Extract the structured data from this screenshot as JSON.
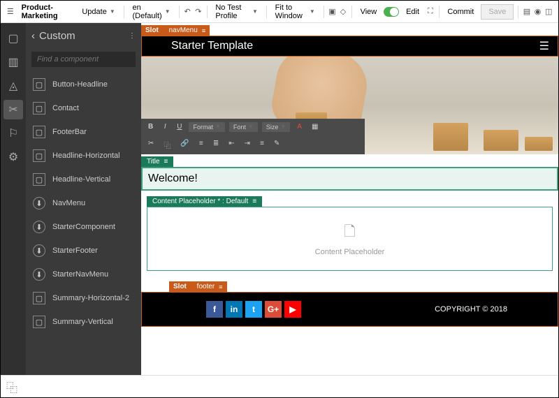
{
  "toolbar": {
    "product": "Product-Marketing",
    "update": "Update",
    "locale": "en (Default)",
    "testProfile": "No Test Profile",
    "fit": "Fit to Window",
    "view": "View",
    "edit": "Edit",
    "commit": "Commit",
    "save": "Save"
  },
  "sidebar": {
    "title": "Custom",
    "searchPlaceholder": "Find a component",
    "items": [
      {
        "label": "Button-Headline",
        "dl": false
      },
      {
        "label": "Contact",
        "dl": false
      },
      {
        "label": "FooterBar",
        "dl": false
      },
      {
        "label": "Headline-Horizontal",
        "dl": false
      },
      {
        "label": "Headline-Vertical",
        "dl": false
      },
      {
        "label": "NavMenu",
        "dl": true
      },
      {
        "label": "StarterComponent",
        "dl": true
      },
      {
        "label": "StarterFooter",
        "dl": true
      },
      {
        "label": "StarterNavMenu",
        "dl": true
      },
      {
        "label": "Summary-Horizontal-2",
        "dl": false
      },
      {
        "label": "Summary-Vertical",
        "dl": false
      }
    ]
  },
  "canvas": {
    "slotNav": {
      "slot": "Slot",
      "name": "navMenu"
    },
    "navTitle": "Starter Template",
    "rte": {
      "bold": "B",
      "italic": "I",
      "underline": "U",
      "format": "Format",
      "font": "Font",
      "size": "Size"
    },
    "titleTag": "Title",
    "titleText": "Welcome!",
    "cpTag": "Content Placeholder  * : Default",
    "cpText": "Content Placeholder",
    "slotFooter": {
      "slot": "Slot",
      "name": "footer"
    },
    "copyright": "COPYRIGHT © 2018"
  }
}
